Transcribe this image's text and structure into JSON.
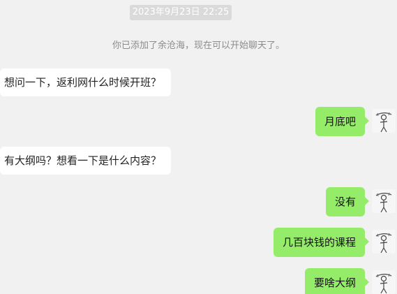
{
  "timestamp": "2023年9月23日 22:25",
  "system_message": "你已添加了余沧海，现在可以开始聊天了。",
  "messages": [
    {
      "side": "left",
      "text": "想问一下，返利网什么时候开班？"
    },
    {
      "side": "right",
      "text": "月底吧"
    },
    {
      "side": "left",
      "text": "有大纲吗？想看一下是什么内容？"
    },
    {
      "side": "right",
      "text": "没有"
    },
    {
      "side": "right",
      "text": "几百块钱的课程"
    },
    {
      "side": "right",
      "text": "要啥大纲"
    }
  ],
  "colors": {
    "background": "#f1f1f1",
    "incoming_bubble": "#ffffff",
    "outgoing_bubble": "#95ec69",
    "timestamp_bg": "#dadada",
    "system_text": "#8c8c8c"
  },
  "icons": {
    "avatar": "sketch-figure-avatar-icon"
  }
}
